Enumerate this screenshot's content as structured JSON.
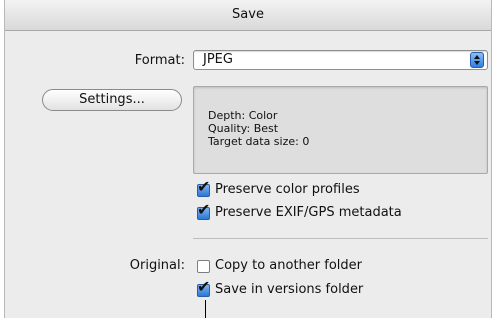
{
  "window": {
    "title": "Save"
  },
  "format": {
    "label": "Format:",
    "value": "JPEG"
  },
  "settings_button": {
    "label": "Settings..."
  },
  "info": {
    "depth": "Depth: Color",
    "quality": "Quality: Best",
    "target_size": "Target data size: 0"
  },
  "options": {
    "preserve_color_profiles": {
      "label": "Preserve color profiles",
      "checked": true
    },
    "preserve_exif": {
      "label": "Preserve EXIF/GPS metadata",
      "checked": true
    }
  },
  "original": {
    "label": "Original:",
    "copy_to_folder": {
      "label": "Copy to another folder",
      "checked": false
    },
    "save_in_versions": {
      "label": "Save in versions folder",
      "checked": true
    }
  }
}
